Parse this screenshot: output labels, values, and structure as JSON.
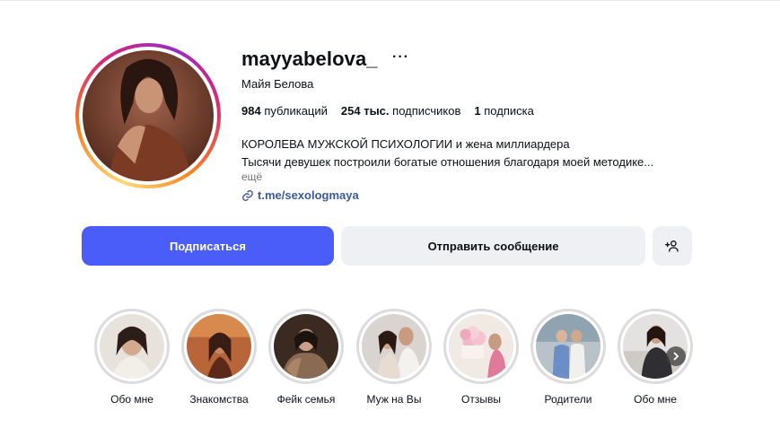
{
  "profile": {
    "username": "mayyabelova_",
    "more_glyph": "···",
    "full_name": "Майя Белова",
    "stats": {
      "posts_count": "984",
      "posts_label": "публикаций",
      "followers_count": "254 тыс.",
      "followers_label": "подписчиков",
      "following_count": "1",
      "following_label": "подписка"
    },
    "bio_line1": "КОРОЛЕВА МУЖСКОЙ ПСИХОЛОГИИ и жена миллиардера",
    "bio_line2": "Тысячи девушек построили богатые отношения благодаря моей методике...",
    "more_link": "ещё",
    "link": "t.me/sexologmaya"
  },
  "actions": {
    "follow_label": "Подписаться",
    "message_label": "Отправить сообщение",
    "add_user_icon": "add-user-icon"
  },
  "highlights": [
    {
      "label": "Обо мне"
    },
    {
      "label": "Знакомства"
    },
    {
      "label": "Фейк семья"
    },
    {
      "label": "Муж на Вы"
    },
    {
      "label": "Отзывы"
    },
    {
      "label": "Родители"
    },
    {
      "label": "Обо мне"
    }
  ],
  "colors": {
    "primary_button": "#4a5df9",
    "secondary_button": "#eff0f3",
    "link": "#3c5a99",
    "highlight_ring": "#dbdbe0"
  }
}
